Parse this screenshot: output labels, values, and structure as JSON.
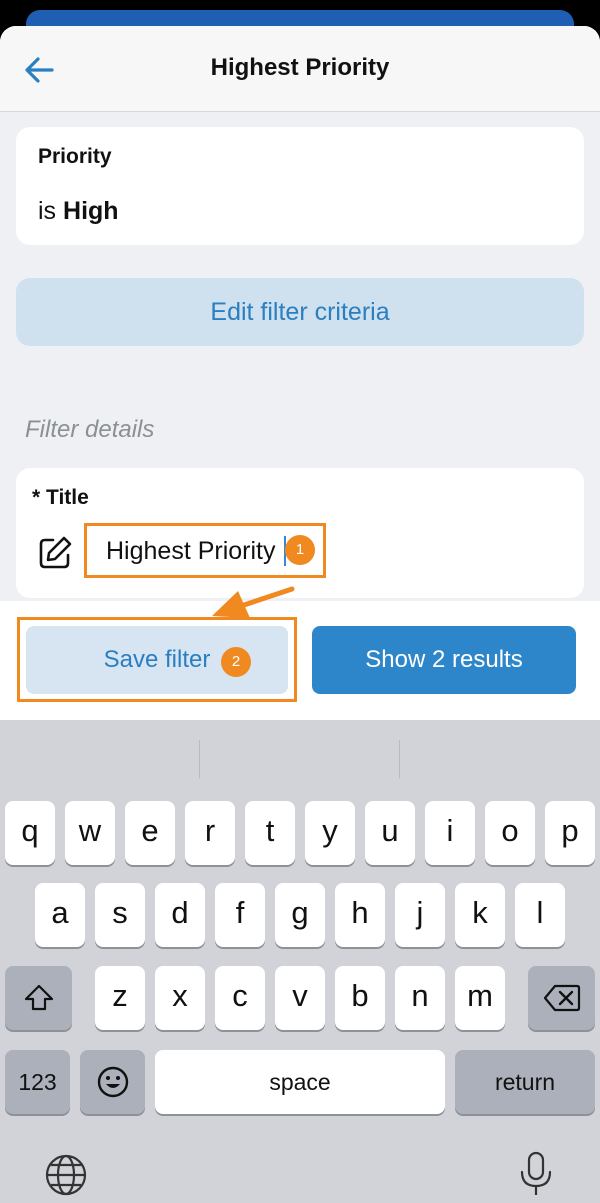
{
  "header": {
    "back_icon": "back-arrow-icon",
    "title": "Highest Priority"
  },
  "criteria": {
    "field": "Priority",
    "operator": "is",
    "value": "High"
  },
  "edit_criteria_label": "Edit filter criteria",
  "filter_details": {
    "section_label": "Filter details",
    "title_label": "* Title",
    "edit_icon": "pencil-edit-icon",
    "title_value": "Highest Priority"
  },
  "actions": {
    "save_label": "Save filter",
    "show_label": "Show 2 results"
  },
  "annotations": {
    "step1": "1",
    "step2": "2",
    "color": "#f0891f"
  },
  "keyboard": {
    "row1": [
      "q",
      "w",
      "e",
      "r",
      "t",
      "y",
      "u",
      "i",
      "o",
      "p"
    ],
    "row2": [
      "a",
      "s",
      "d",
      "f",
      "g",
      "h",
      "j",
      "k",
      "l"
    ],
    "row3": [
      "z",
      "x",
      "c",
      "v",
      "b",
      "n",
      "m"
    ],
    "shift_icon": "shift-icon",
    "delete_icon": "backspace-icon",
    "numbers_label": "123",
    "emoji_icon": "emoji-icon",
    "space_label": "space",
    "return_label": "return",
    "globe_icon": "globe-icon",
    "mic_icon": "microphone-icon"
  },
  "colors": {
    "accent": "#2d86c9",
    "link": "#2a7fc0",
    "highlight": "#f0891f"
  }
}
